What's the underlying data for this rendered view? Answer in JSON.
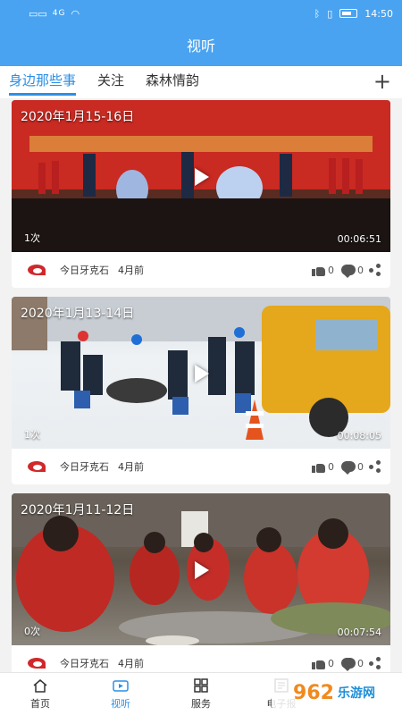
{
  "status": {
    "signal": "4G",
    "time": "14:50"
  },
  "header": {
    "title": "视听"
  },
  "tabs": [
    {
      "label": "身边那些事",
      "active": true
    },
    {
      "label": "关注",
      "active": false
    },
    {
      "label": "森林情韵",
      "active": false
    }
  ],
  "add_label": "+",
  "videos": [
    {
      "title": "2020年1月15-16日",
      "views": "1次",
      "duration": "00:06:51",
      "source": "今日牙克石",
      "time": "4月前",
      "likes": "0",
      "comments": "0"
    },
    {
      "title": "2020年1月13-14日",
      "views": "1次",
      "duration": "00:08:05",
      "source": "今日牙克石",
      "time": "4月前",
      "likes": "0",
      "comments": "0"
    },
    {
      "title": "2020年1月11-12日",
      "views": "0次",
      "duration": "00:07:54",
      "source": "今日牙克石",
      "time": "4月前",
      "likes": "0",
      "comments": "0"
    }
  ],
  "nav": [
    {
      "label": "首页",
      "icon": "home-icon",
      "active": false
    },
    {
      "label": "视听",
      "icon": "video-icon",
      "active": true
    },
    {
      "label": "服务",
      "icon": "grid-icon",
      "active": false
    },
    {
      "label": "电子报",
      "icon": "newspaper-icon",
      "active": false
    }
  ],
  "watermark": {
    "big": "962",
    "small": "乐游网"
  },
  "colors": {
    "primary": "#4aa3f0",
    "accent": "#2b8fe6"
  }
}
